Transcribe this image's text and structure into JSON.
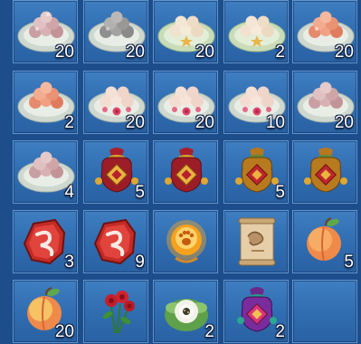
{
  "slots": [
    {
      "icon": "mochi-plate-pink-icon",
      "count": "20"
    },
    {
      "icon": "mochi-plate-grey-icon",
      "count": "20"
    },
    {
      "icon": "mochi-plate-white-star-icon",
      "count": "20"
    },
    {
      "icon": "mochi-plate-white-star-icon",
      "count": "2"
    },
    {
      "icon": "mochi-plate-orange-icon",
      "count": "20"
    },
    {
      "icon": "mochi-plate-orange-icon",
      "count": "2"
    },
    {
      "icon": "mochi-plate-rose-icon",
      "count": "20"
    },
    {
      "icon": "mochi-plate-rose-icon",
      "count": "20"
    },
    {
      "icon": "mochi-plate-rose-icon",
      "count": "10"
    },
    {
      "icon": "mochi-plate-pink-icon",
      "count": "20"
    },
    {
      "icon": "mochi-plate-pink-icon",
      "count": "4"
    },
    {
      "icon": "lucky-bag-red-icon",
      "count": "5"
    },
    {
      "icon": "lucky-bag-red-icon",
      "count": ""
    },
    {
      "icon": "lucky-bag-gold-icon",
      "count": "5"
    },
    {
      "icon": "lucky-bag-gold-icon",
      "count": ""
    },
    {
      "icon": "red-rune-stone-icon",
      "count": "3"
    },
    {
      "icon": "red-rune-stone-icon",
      "count": "9"
    },
    {
      "icon": "golden-paw-orb-icon",
      "count": ""
    },
    {
      "icon": "treasure-map-scroll-icon",
      "count": ""
    },
    {
      "icon": "peach-icon",
      "count": "5"
    },
    {
      "icon": "peach-icon",
      "count": "20"
    },
    {
      "icon": "red-rose-bouquet-icon",
      "count": ""
    },
    {
      "icon": "white-flower-bundle-icon",
      "count": "2"
    },
    {
      "icon": "lucky-bag-purple-icon",
      "count": "2"
    },
    {
      "icon": "empty-slot",
      "count": ""
    }
  ]
}
